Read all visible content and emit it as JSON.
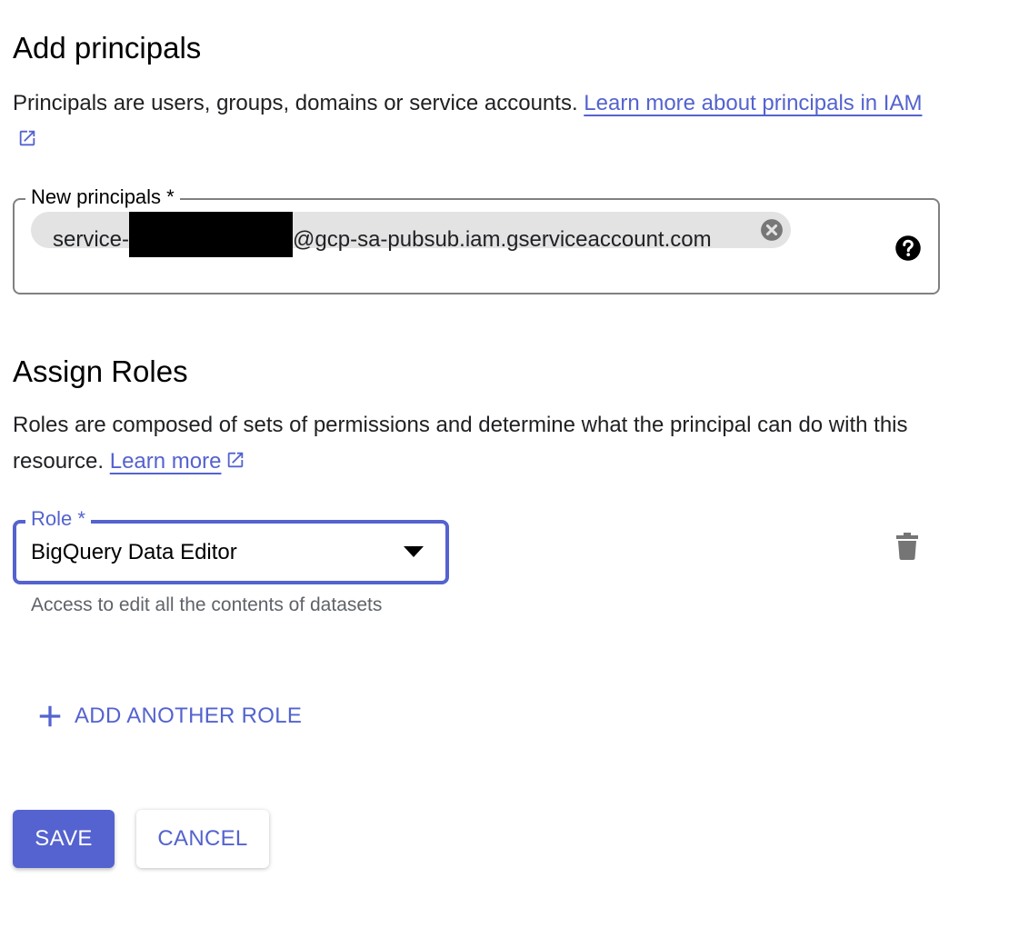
{
  "add_principals": {
    "title": "Add principals",
    "description": "Principals are users, groups, domains or service accounts.",
    "learn_more_link": "Learn more about principals in IAM",
    "new_principals": {
      "label": "New principals *",
      "chip_prefix": "service-",
      "chip_suffix": "@gcp-sa-pubsub.iam.gserviceaccount.com"
    }
  },
  "assign_roles": {
    "title": "Assign Roles",
    "description": "Roles are composed of sets of permissions and determine what the principal can do with this resource.",
    "learn_more_link": "Learn more",
    "role": {
      "label": "Role *",
      "value": "BigQuery Data Editor",
      "hint": "Access to edit all the contents of datasets"
    },
    "add_another_role": "ADD ANOTHER ROLE"
  },
  "actions": {
    "save": "SAVE",
    "cancel": "CANCEL"
  },
  "icons": {
    "external_link": "open-in-new-icon",
    "chip_remove": "cancel-circle-icon",
    "help": "help-icon",
    "dropdown": "arrow-drop-down-icon",
    "delete": "trash-icon",
    "add": "plus-icon"
  },
  "colors": {
    "accent": "#5463cf",
    "text": "#202124",
    "hint": "#5f6368",
    "chip_bg": "#e3e3e3",
    "outline": "#808080"
  }
}
